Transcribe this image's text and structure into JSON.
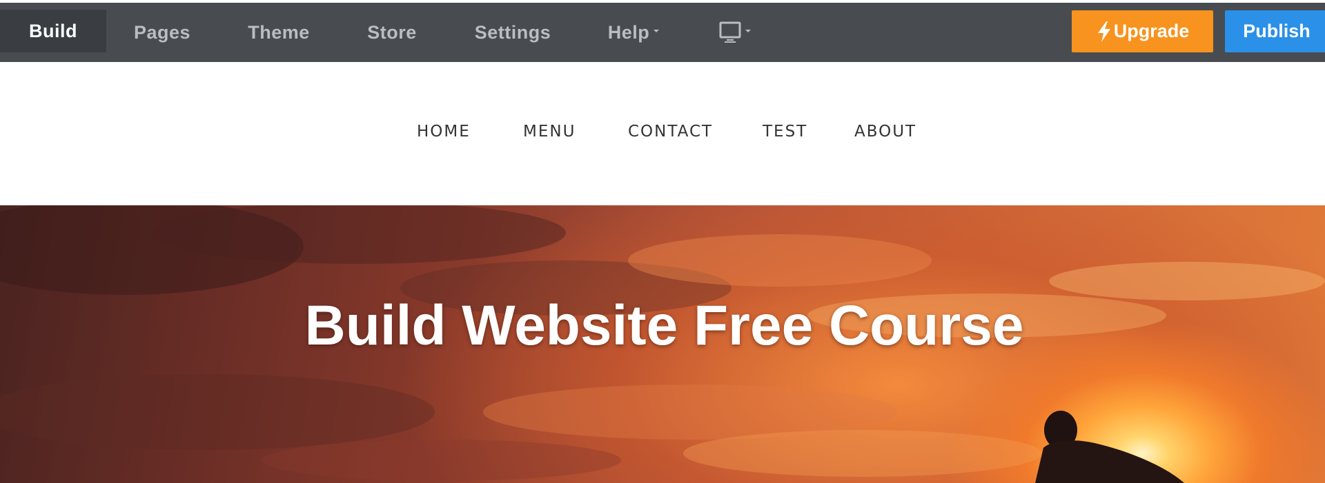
{
  "toolbar": {
    "tabs": [
      {
        "label": "Build",
        "active": true
      },
      {
        "label": "Pages",
        "active": false
      },
      {
        "label": "Theme",
        "active": false
      },
      {
        "label": "Store",
        "active": false
      },
      {
        "label": "Settings",
        "active": false
      },
      {
        "label": "Help",
        "active": false,
        "dropdown": true
      }
    ],
    "device_icon": "desktop-monitor-icon",
    "upgrade_label": "Upgrade",
    "upgrade_icon": "lightning-bolt-icon",
    "publish_label": "Publish",
    "colors": {
      "toolbar_bg": "#484c50",
      "active_tab_bg": "#3a3e42",
      "upgrade": "#f7931e",
      "publish": "#2a90e8"
    }
  },
  "site": {
    "nav": [
      "HOME",
      "MENU",
      "CONTACT",
      "TEST",
      "ABOUT"
    ],
    "hero_title": "Build Website Free Course"
  }
}
